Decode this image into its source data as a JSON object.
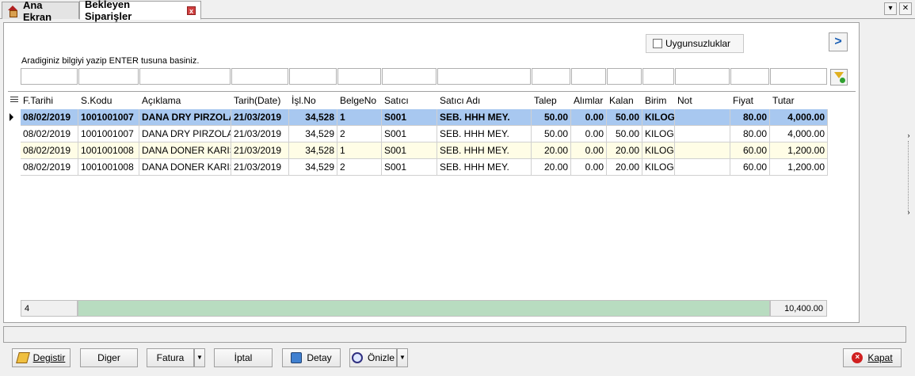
{
  "tabs": [
    {
      "label": "Ana Ekran",
      "icon": "home-icon"
    },
    {
      "label": "Bekleyen Siparişler",
      "icon": "close-icon"
    }
  ],
  "window_buttons": {
    "dropdown": "▾",
    "close": "✕"
  },
  "filters": {
    "uygunsuzluklar_label": "Uygunsuzluklar",
    "uygunsuzluklar_checked": false,
    "hint": "Aradiginiz bilgiyi yazip ENTER tusuna basiniz.",
    "next_icon": ">"
  },
  "grid": {
    "columns": [
      "F.Tarihi",
      "S.Kodu",
      "Açıklama",
      "Tarih(Date)",
      "İşl.No",
      "BelgeNo",
      "Satıcı",
      "Satıcı Adı",
      "Talep",
      "Alımlar",
      "Kalan",
      "Birim",
      "Not",
      "Fiyat",
      "Tutar"
    ],
    "rows": [
      [
        "08/02/2019",
        "1001001007",
        "DANA DRY PIRZOLA",
        "21/03/2019",
        "34,528",
        "1",
        "S001",
        "SEB. HHH  MEY.",
        "50.00",
        "0.00",
        "50.00",
        "KILOG",
        "",
        "80.00",
        "4,000.00"
      ],
      [
        "08/02/2019",
        "1001001007",
        "DANA DRY PIRZOLA",
        "21/03/2019",
        "34,529",
        "2",
        "S001",
        "SEB. HHH  MEY.",
        "50.00",
        "0.00",
        "50.00",
        "KILOG",
        "",
        "80.00",
        "4,000.00"
      ],
      [
        "08/02/2019",
        "1001001008",
        "DANA DONER KARIS",
        "21/03/2019",
        "34,528",
        "1",
        "S001",
        "SEB. HHH  MEY.",
        "20.00",
        "0.00",
        "20.00",
        "KILOG",
        "",
        "60.00",
        "1,200.00"
      ],
      [
        "08/02/2019",
        "1001001008",
        "DANA DONER KARIS",
        "21/03/2019",
        "34,529",
        "2",
        "S001",
        "SEB. HHH  MEY.",
        "20.00",
        "0.00",
        "20.00",
        "KILOG",
        "",
        "60.00",
        "1,200.00"
      ]
    ],
    "footer": {
      "count": "4",
      "total": "10,400.00"
    },
    "colors": {
      "selected": "#a8c8f0",
      "alt": "#fffde6",
      "footer_bar": "#b8dcc0"
    }
  },
  "buttons": {
    "degistir": "Degistir",
    "diger": "Diger",
    "fatura": "Fatura",
    "iptal": "İptal",
    "detay": "Detay",
    "onizle": "Önizle",
    "kapat": "Kapat"
  }
}
